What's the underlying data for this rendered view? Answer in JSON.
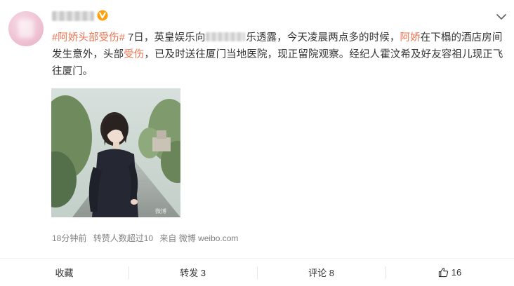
{
  "post": {
    "topic_parts": [
      "#",
      "阿娇",
      "头部",
      "受伤",
      "#"
    ],
    "text": {
      "p1": " 7日，英皇娱乐向",
      "p2": "乐透露，今天凌晨两点多的时候，",
      "kw1": "阿娇",
      "p3": "在下榻的酒店房间发生意外，头部",
      "kw2": "受伤",
      "p4": "，已及时送往厦门当地医院，现正留院观察。经纪人霍汶希及好友容祖儿现正飞往厦门。"
    },
    "photo_watermark": "微博",
    "meta": {
      "time": "18分钟前",
      "reposts_note": "转赞人数超过10",
      "source": "来自 微博 weibo.com"
    }
  },
  "actions": {
    "collect": "收藏",
    "repost": "转发 3",
    "comment": "评论 8",
    "like": "16"
  },
  "colors": {
    "accent": "#eb7350",
    "verified": "#ffa00a",
    "meta_text": "#808080"
  },
  "icons": [
    "verified-badge-icon",
    "chevron-down-icon",
    "thumbs-up-icon"
  ]
}
